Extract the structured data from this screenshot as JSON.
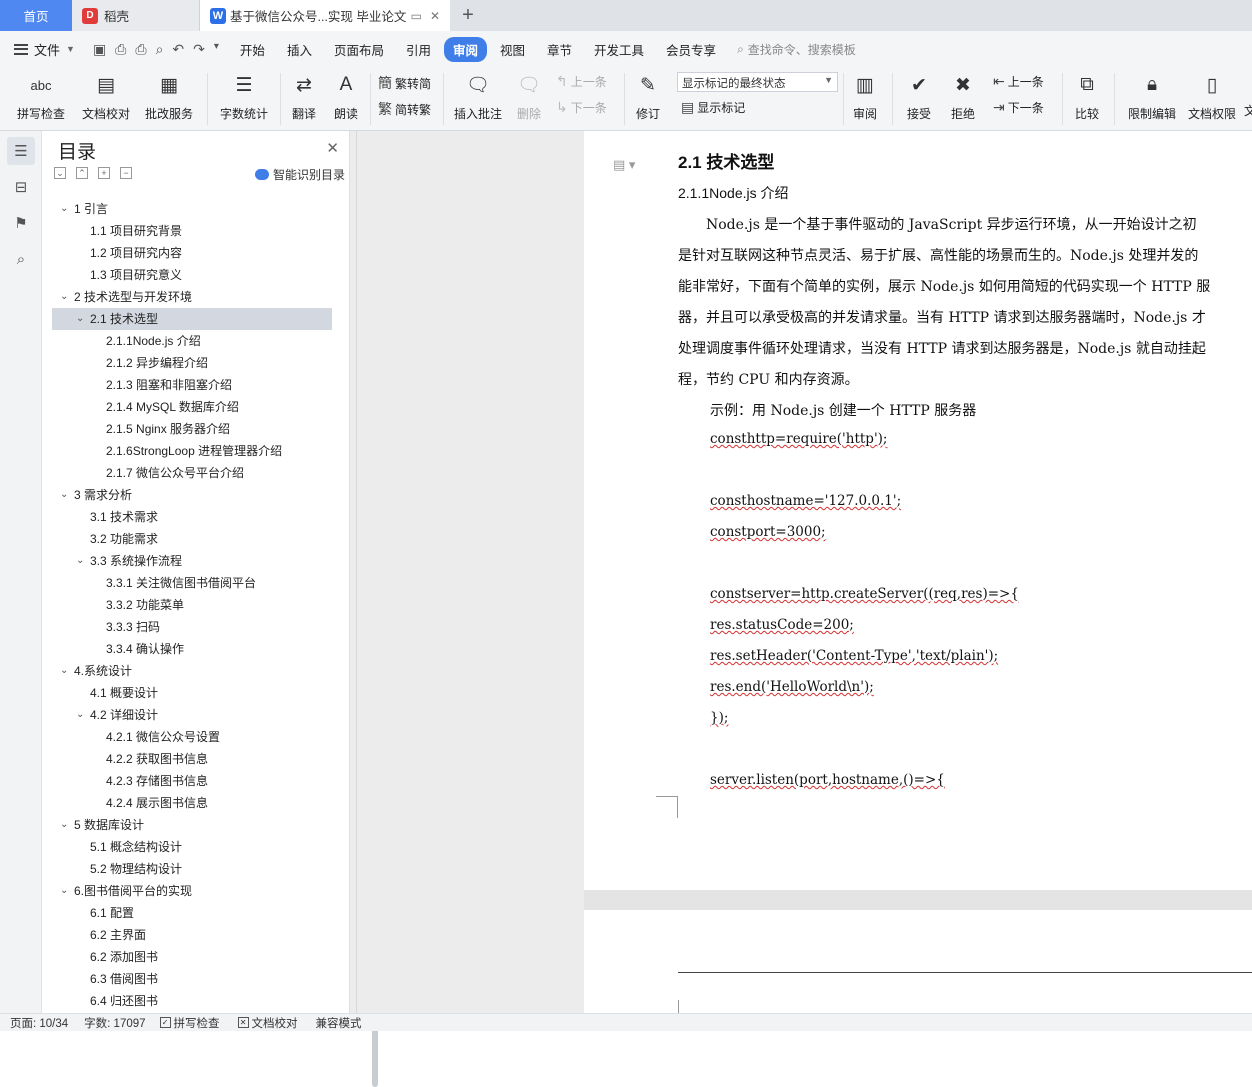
{
  "tabs": {
    "home": "首页",
    "daoke": "稻壳",
    "doc": "基于微信公众号...实现 毕业论文",
    "new_tab": "+"
  },
  "menu": {
    "file": "文件",
    "items": [
      "开始",
      "插入",
      "页面布局",
      "引用",
      "审阅",
      "视图",
      "章节",
      "开发工具",
      "会员专享"
    ],
    "active": "审阅",
    "search_placeholder": "查找命令、搜索模板"
  },
  "ribbon": {
    "spell_check": "拼写检查",
    "spell_icon_text": "abc",
    "doc_proof": "文档校对",
    "batch_service": "批改服务",
    "word_count": "字数统计",
    "translate": "翻译",
    "read_aloud": "朗读",
    "trad_to_simp": "繁转简",
    "simp_to_trad": "简转繁",
    "insert_comment": "插入批注",
    "delete": "删除",
    "prev_comment": "上一条",
    "next_comment": "下一条",
    "revise": "修订",
    "show_markup_state": "显示标记的最终状态",
    "show_markup": "显示标记",
    "review": "审阅",
    "accept": "接受",
    "reject": "拒绝",
    "prev_change": "上一条",
    "next_change": "下一条",
    "compare": "比较",
    "restrict_edit": "限制编辑",
    "doc_permission": "文档权限",
    "cut_off": "文"
  },
  "toc": {
    "title": "目录",
    "smart_label": "智能识别目录",
    "items": [
      {
        "text": "1 引言",
        "level": 1,
        "expanded": true
      },
      {
        "text": "1.1 项目研究背景",
        "level": 2
      },
      {
        "text": "1.2 项目研究内容",
        "level": 2
      },
      {
        "text": "1.3 项目研究意义",
        "level": 2
      },
      {
        "text": "2 技术选型与开发环境",
        "level": 1,
        "expanded": true
      },
      {
        "text": "2.1 技术选型",
        "level": 2,
        "expanded": true,
        "selected": true
      },
      {
        "text": "2.1.1Node.js 介绍",
        "level": 3
      },
      {
        "text": "2.1.2 异步编程介绍",
        "level": 3
      },
      {
        "text": "2.1.3 阻塞和非阻塞介绍",
        "level": 3
      },
      {
        "text": "2.1.4 MySQL 数据库介绍",
        "level": 3
      },
      {
        "text": "2.1.5 Nginx 服务器介绍",
        "level": 3
      },
      {
        "text": "2.1.6StrongLoop 进程管理器介绍",
        "level": 3
      },
      {
        "text": "2.1.7 微信公众号平台介绍",
        "level": 3
      },
      {
        "text": "3 需求分析",
        "level": 1,
        "expanded": true
      },
      {
        "text": "3.1 技术需求",
        "level": 2
      },
      {
        "text": "3.2 功能需求",
        "level": 2
      },
      {
        "text": "3.3 系统操作流程",
        "level": 2,
        "expanded": true
      },
      {
        "text": "3.3.1 关注微信图书借阅平台",
        "level": 3
      },
      {
        "text": "3.3.2 功能菜单",
        "level": 3
      },
      {
        "text": "3.3.3 扫码",
        "level": 3
      },
      {
        "text": "3.3.4 确认操作",
        "level": 3
      },
      {
        "text": "4.系统设计",
        "level": 1,
        "expanded": true
      },
      {
        "text": "4.1 概要设计",
        "level": 2
      },
      {
        "text": "4.2 详细设计",
        "level": 2,
        "expanded": true
      },
      {
        "text": "4.2.1 微信公众号设置",
        "level": 3
      },
      {
        "text": "4.2.2 获取图书信息",
        "level": 3
      },
      {
        "text": "4.2.3 存储图书信息",
        "level": 3
      },
      {
        "text": "4.2.4 展示图书信息",
        "level": 3
      },
      {
        "text": "5 数据库设计",
        "level": 1,
        "expanded": true
      },
      {
        "text": "5.1 概念结构设计",
        "level": 2
      },
      {
        "text": "5.2 物理结构设计",
        "level": 2
      },
      {
        "text": "6.图书借阅平台的实现",
        "level": 1,
        "expanded": true
      },
      {
        "text": "6.1 配置",
        "level": 2
      },
      {
        "text": "6.2 主界面",
        "level": 2
      },
      {
        "text": "6.2 添加图书",
        "level": 2
      },
      {
        "text": "6.3 借阅图书",
        "level": 2
      },
      {
        "text": "6.4 归还图书",
        "level": 2
      }
    ]
  },
  "document": {
    "heading": "2.1 技术选型",
    "subheading": "2.1.1Node.js 介绍",
    "para_lines": [
      "　　Node.js 是一个基于事件驱动的 JavaScript 异步运行环境，从一开始设计之初",
      "是针对互联网这种节点灵活、易于扩展、高性能的场景而生的。Node.js 处理并发的",
      "能非常好，下面有个简单的实例，展示 Node.js 如何用简短的代码实现一个 HTTP 服",
      "器，并且可以承受极高的并发请求量。当有 HTTP 请求到达服务器端时，Node.js 才",
      "处理调度事件循环处理请求，当没有 HTTP 请求到达服务器是，Node.js 就自动挂起",
      "程，节约 CPU 和内存资源。"
    ],
    "example_line": "示例：用 Node.js 创建一个 HTTP 服务器",
    "code_lines": [
      "consthttp=require('http');",
      "",
      "consthostname='127.0.0.1';",
      "constport=3000;",
      "",
      "constserver=http.createServer((req,res)=>{",
      "res.statusCode=200;",
      "res.setHeader('Content-Type','text/plain');",
      "res.end('HelloWorld\\n');",
      "});",
      "",
      "server.listen(port,hostname,()=>{"
    ]
  },
  "status": {
    "page": "页面: 10/34",
    "words": "字数: 17097",
    "spell": "拼写检查",
    "proof": "文档校对",
    "compat": "兼容模式"
  }
}
